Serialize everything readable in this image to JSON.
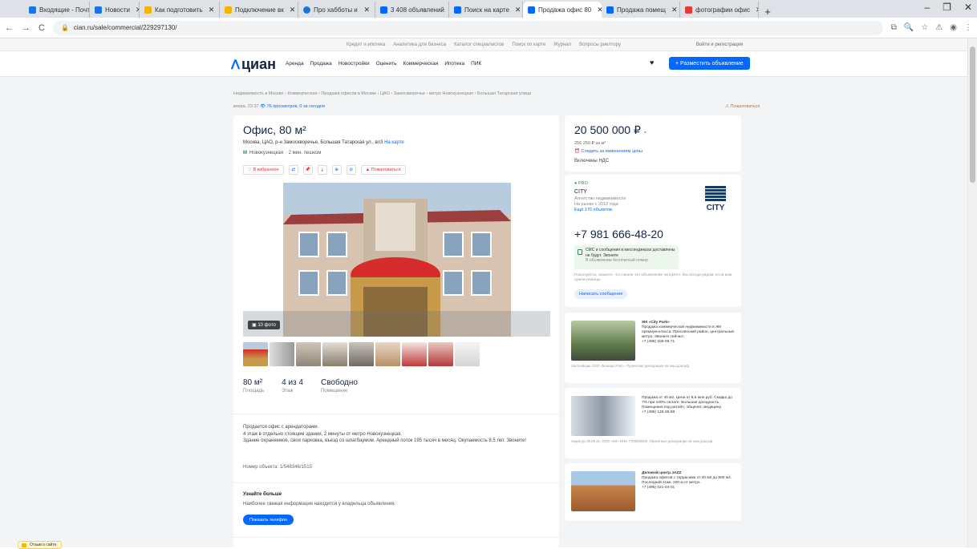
{
  "browser": {
    "tabs": [
      {
        "label": "Входящие - Почта"
      },
      {
        "label": "Новости"
      },
      {
        "label": "Как подготовить"
      },
      {
        "label": "Подключение вк"
      },
      {
        "label": "Про хабботы и"
      },
      {
        "label": "3 408 объявлений"
      },
      {
        "label": "Поиск на карте"
      },
      {
        "label": "Продажа офис 80",
        "active": true
      },
      {
        "label": "Продажа помещ"
      },
      {
        "label": "фотографии офис"
      }
    ],
    "new_tab": "+",
    "url": "cian.ru/sale/commercial/229297130/"
  },
  "topline": {
    "links": [
      "Кредит и ипотека",
      "Аналитика для бизнеса",
      "Каталог специалистов",
      "Поиск по карте",
      "Журнал",
      "Вопросы риелтору"
    ],
    "login": "Войти и регистрация"
  },
  "header": {
    "logo": "циан",
    "nav": [
      "Аренда",
      "Продажа",
      "Новостройки",
      "Оценить",
      "Коммерческая",
      "Ипотека",
      "ПИК"
    ],
    "post_button": "+ Разместить объявление"
  },
  "breadcrumbs": "Недвижимость в Москве › Коммерческая › Продажа офисов в Москве › ЦАО › Замоскворечье › метро Новокузнецкая › Большая Татарская улица",
  "meta": {
    "updated": "вчера, 22:37",
    "views": "76 просмотров, 0 за сегодня",
    "complain": "Пожаловаться"
  },
  "listing": {
    "title": "Офис, 80 м²",
    "address": "Москва, ЦАО, р-н Замоскворечье, Большая Татарская ул., вл3",
    "map_link": "На карте",
    "metro": "Новокузнецкая",
    "metro_time": "· 2 мин. пешком",
    "actions": {
      "favorite": "В избранное",
      "report": "Пожаловаться"
    },
    "photo_count": "10 фото",
    "facts": [
      {
        "value": "80 м²",
        "label": "Площадь"
      },
      {
        "value": "4 из 4",
        "label": "Этаж"
      },
      {
        "value": "Свободно",
        "label": "Помещение"
      }
    ],
    "description": [
      "Продается офис с арендаторами.",
      "4 этаж в отдельно стоящем здании, 2 минуты от метро Новокузнецкая.",
      "Здание охраняемое, своя парковка, въезд со шлагбаумом. Арендный поток 195 тысяч в месяц. Окупаемость 8,5 лет. Звоните!"
    ],
    "object_number": "Номер объекта: 1/548346/1515",
    "learn_more_title": "Узнайте больше",
    "learn_more_text": "Наиболее свежая информация находится у владельца объявления.",
    "show_phone": "Показать телефон"
  },
  "price": {
    "value": "20 500 000 ₽",
    "per_meter": "256 250 ₽ за м²",
    "follow": "Следить за изменением цены",
    "vat": "Включены НДС"
  },
  "agent": {
    "badge": "PRO",
    "name": "CITY",
    "type": "Агентство недвижимости",
    "since": "На рынке с 2012 года",
    "offers_link": "Ещё 170 объектов",
    "logo_text": "CITY",
    "phone": "+7 981 666-48-20",
    "sms_title": "СМС и сообщения в мессенджерах доставлены не будут. Звоните",
    "sms_sub": "В объявлении бесплатный номер",
    "note": "Пожалуйста, скажите, что нашли это объявление на ЦИАН. Мы всегда рядом, если вам нужна помощь",
    "write_button": "Написать сообщение"
  },
  "ads": [
    {
      "title": "ЖК «Сity Park»",
      "text": "Продажа коммерческой недвижимости в ЖК премиум-класса. Пресненский район, центральный метро. Звоните сейчас!",
      "phone": "+7 (495) 106-06-71",
      "footer": "Застройщик ООО «Монарх РЭС». Проектная декларация на наш.дом.рф"
    },
    {
      "title": "",
      "text": "Продажа от 40 м2. Цена от 8,5 млн руб. Скидка до 7% при 100% оплате. Большая доходность. Помещения под ритейл, общепит, медицину.",
      "phone": "+7 (495) 126-35-58",
      "footer": "Акция до 30.09.21. ООО «КЛ» ИНН 7703000000. Проектные декларации на наш.дом.рф"
    },
    {
      "title": "Деловой центр JAZZ",
      "text": "Продажа офисов с террасами от 40 м2 до 800 м2. Последний этаж, 200 м от метро.",
      "phone": "+7 (495) 021-04-01",
      "footer": ""
    }
  ],
  "feedback": "Отзыв о сайте"
}
